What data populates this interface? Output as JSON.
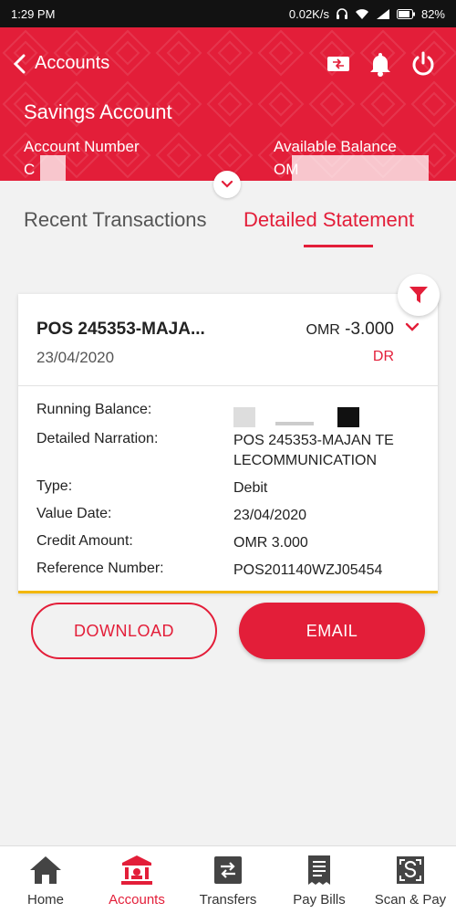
{
  "status_bar": {
    "time": "1:29 PM",
    "network_speed": "0.02K/s",
    "battery": "82%"
  },
  "header": {
    "back_label": "Accounts",
    "account_title": "Savings Account",
    "account_number_label": "Account Number",
    "account_number_value": "C",
    "balance_label": "Available Balance",
    "balance_value": "OM",
    "icons": [
      "card-transfer-icon",
      "bell-icon",
      "power-icon"
    ]
  },
  "tabs": {
    "recent": "Recent Transactions",
    "detailed": "Detailed Statement",
    "active": "detailed"
  },
  "transaction": {
    "title": "POS 245353-MAJA...",
    "date": "23/04/2020",
    "currency": "OMR",
    "amount": "-3.000",
    "type_code": "DR",
    "details": [
      {
        "label": "Running Balance:",
        "value": ""
      },
      {
        "label": "Detailed Narration:",
        "value": "POS 245353-MAJAN TE LECOMMUNICATION"
      },
      {
        "label": "Type:",
        "value": "Debit"
      },
      {
        "label": "Value Date:",
        "value": "23/04/2020"
      },
      {
        "label": "Credit Amount:",
        "value": "OMR 3.000"
      },
      {
        "label": "Reference Number:",
        "value": "POS201140WZJ05454"
      }
    ]
  },
  "actions": {
    "download": "DOWNLOAD",
    "email": "EMAIL"
  },
  "bottom_nav": [
    {
      "label": "Home",
      "icon": "home-icon",
      "active": false
    },
    {
      "label": "Accounts",
      "icon": "bank-icon",
      "active": true
    },
    {
      "label": "Transfers",
      "icon": "transfer-icon",
      "active": false
    },
    {
      "label": "Pay Bills",
      "icon": "bill-icon",
      "active": false
    },
    {
      "label": "Scan & Pay",
      "icon": "scan-icon",
      "active": false
    }
  ],
  "colors": {
    "brand_red": "#e31e39",
    "accent_yellow": "#f3b700"
  }
}
